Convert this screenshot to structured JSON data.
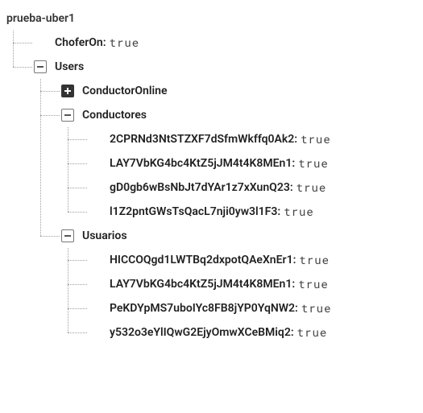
{
  "root": {
    "label": "prueba-uber1",
    "items": [
      {
        "key": "ChoferOn",
        "value": "true",
        "type": "leaf"
      },
      {
        "key": "Users",
        "type": "expanded",
        "items": [
          {
            "key": "ConductorOnline",
            "type": "collapsed"
          },
          {
            "key": "Conductores",
            "type": "expanded",
            "items": [
              {
                "key": "2CPRNd3NtSTZXF7dSfmWkffq0Ak2",
                "value": "true",
                "type": "leaf"
              },
              {
                "key": "LAY7VbKG4bc4KtZ5jJM4t4K8MEn1",
                "value": "true",
                "type": "leaf"
              },
              {
                "key": "gD0gb6wBsNbJt7dYAr1z7xXunQ23",
                "value": "true",
                "type": "leaf"
              },
              {
                "key": "l1Z2pntGWsTsQacL7nji0yw3l1F3",
                "value": "true",
                "type": "leaf"
              }
            ]
          },
          {
            "key": "Usuarios",
            "type": "expanded",
            "items": [
              {
                "key": "HICCOQgd1LWTBq2dxpotQAeXnEr1",
                "value": "true",
                "type": "leaf"
              },
              {
                "key": "LAY7VbKG4bc4KtZ5jJM4t4K8MEn1",
                "value": "true",
                "type": "leaf"
              },
              {
                "key": "PeKDYpMS7uboIYc8FB8jYP0YqNW2",
                "value": "true",
                "type": "leaf"
              },
              {
                "key": "y532o3eYlIQwG2EjyOmwXCeBMiq2",
                "value": "true",
                "type": "leaf"
              }
            ]
          }
        ]
      }
    ]
  }
}
